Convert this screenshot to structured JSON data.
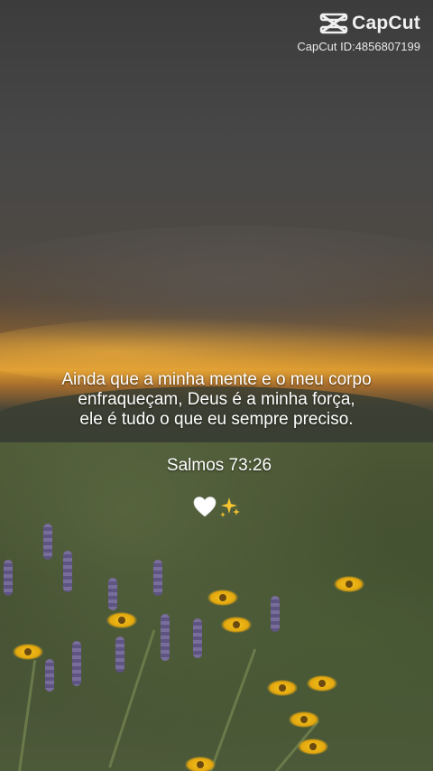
{
  "watermark": {
    "brand": "CapCut",
    "id_line": "CapCut ID:4856807199",
    "icon": "capcut-logo-icon"
  },
  "quote": {
    "lines": [
      "Ainda que a minha mente e o meu corpo",
      "enfraqueçam, Deus é a minha força,",
      "ele é tudo o que eu sempre preciso."
    ],
    "reference": "Salmos 73:26"
  },
  "emojis": [
    "white-heart-icon",
    "sparkles-icon"
  ],
  "colors": {
    "text": "#ffffff",
    "sunset": "#d9982e",
    "flower": "#f2c21b",
    "lupine": "#7d6fa6"
  }
}
